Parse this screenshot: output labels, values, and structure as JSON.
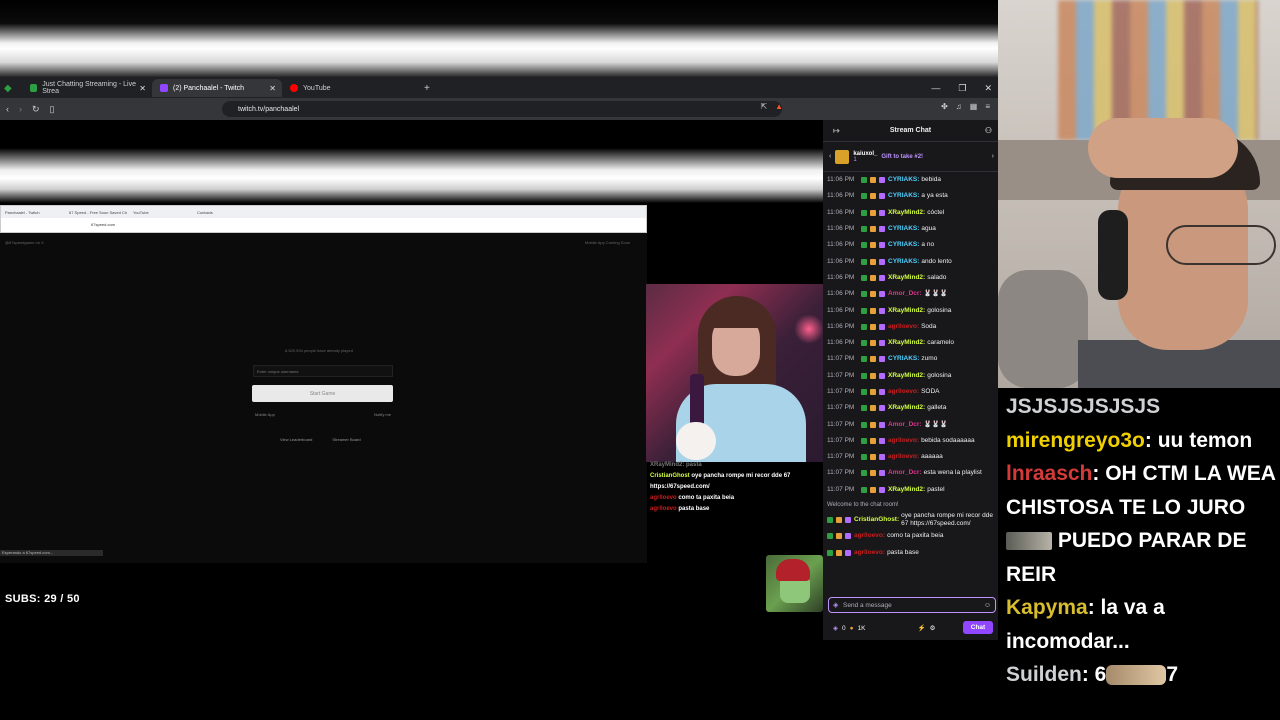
{
  "browser": {
    "tabs": [
      {
        "label": "Just Chatting Streaming - Live Strea",
        "color": "#2ea043"
      },
      {
        "label": "(2) Panchaalel - Twitch",
        "color": "#9147ff"
      },
      {
        "label": "YouTube",
        "color": "#ff0000"
      }
    ],
    "url": "twitch.tv/panchaalel"
  },
  "inner_page": {
    "tab_labels": [
      "Panchaalel - Twitch",
      "67 Speed - Free Soon Saved Ch",
      "YouTube",
      "Contacts"
    ],
    "url": "67speed.com",
    "header_left": "@67speedgame on X",
    "header_right": "Mobile App Coming Soon",
    "player_count": "6,520,934 people have already played",
    "username_placeholder": "Enter unique username",
    "start_button": "Start Game",
    "mobile_app": "Mobile App",
    "notify": "Notify me",
    "leaderboard": "View Leaderboard",
    "streamer_board": "Streamer Board",
    "status": "Esperando a 67speed.com..."
  },
  "overlay_chat": {
    "header": "XRayMind2: pasta",
    "lines": [
      {
        "user": "CristianGhost",
        "text": "oye pancha rompe mi recor dde 67 https://67speed.com/",
        "color": "#d4ff3f"
      },
      {
        "user": "agrlloevo",
        "text": "como ta paxita beia",
        "color": "#c81e1e"
      },
      {
        "user": "agrlloevo",
        "text": "pasta base",
        "color": "#c81e1e"
      }
    ]
  },
  "subs": "SUBS: 29 / 50",
  "chat": {
    "title": "Stream Chat",
    "pinned_user": "kaiuxol_",
    "pinned_count": "1",
    "pinned_text": "Gift to take #2!",
    "messages": [
      {
        "time": "11:06 PM",
        "user": "CYRIAKS",
        "text": "bebida",
        "color": "#4fd1ff"
      },
      {
        "time": "11:06 PM",
        "user": "CYRIAKS",
        "text": "a ya esta",
        "color": "#4fd1ff"
      },
      {
        "time": "11:06 PM",
        "user": "XRayMind2",
        "text": "cóctel",
        "color": "#d4ff3f"
      },
      {
        "time": "11:06 PM",
        "user": "CYRIAKS",
        "text": "agua",
        "color": "#4fd1ff"
      },
      {
        "time": "11:06 PM",
        "user": "CYRIAKS",
        "text": "a no",
        "color": "#4fd1ff"
      },
      {
        "time": "11:06 PM",
        "user": "CYRIAKS",
        "text": "ando lento",
        "color": "#4fd1ff"
      },
      {
        "time": "11:06 PM",
        "user": "XRayMind2",
        "text": "salado",
        "color": "#d4ff3f"
      },
      {
        "time": "11:06 PM",
        "user": "Amor_Dcr",
        "text": "🐰🐰🐰",
        "color": "#e0368a"
      },
      {
        "time": "11:06 PM",
        "user": "XRayMind2",
        "text": "golosina",
        "color": "#d4ff3f"
      },
      {
        "time": "11:06 PM",
        "user": "agrlloevo",
        "text": "Soda",
        "color": "#c81e1e"
      },
      {
        "time": "11:06 PM",
        "user": "XRayMind2",
        "text": "caramelo",
        "color": "#d4ff3f"
      },
      {
        "time": "11:07 PM",
        "user": "CYRIAKS",
        "text": "zumo",
        "color": "#4fd1ff"
      },
      {
        "time": "11:07 PM",
        "user": "XRayMind2",
        "text": "golosina",
        "color": "#d4ff3f"
      },
      {
        "time": "11:07 PM",
        "user": "agrlloevo",
        "text": "SODA",
        "color": "#c81e1e"
      },
      {
        "time": "11:07 PM",
        "user": "XRayMind2",
        "text": "galleta",
        "color": "#d4ff3f"
      },
      {
        "time": "11:07 PM",
        "user": "Amor_Dcr",
        "text": "🐰🐰🐰",
        "color": "#e0368a"
      },
      {
        "time": "11:07 PM",
        "user": "agrlloevo",
        "text": "bebida sodaaaaaa",
        "color": "#c81e1e"
      },
      {
        "time": "11:07 PM",
        "user": "agrlloevo",
        "text": "aaaaaa",
        "color": "#c81e1e"
      },
      {
        "time": "11:07 PM",
        "user": "Amor_Dcr",
        "text": "esta wena la playlist",
        "color": "#e0368a"
      },
      {
        "time": "11:07 PM",
        "user": "XRayMind2",
        "text": "pastel",
        "color": "#d4ff3f"
      }
    ],
    "welcome": "Welcome to the chat room!",
    "recent": [
      {
        "user": "CristianGhost",
        "text": "oye pancha rompe mi recor dde 67 https://67speed.com/",
        "color": "#d4ff3f"
      },
      {
        "user": "agrlloevo",
        "text": "como ta paxita beia",
        "color": "#c81e1e"
      },
      {
        "user": "agrlloevo",
        "text": "pasta base",
        "color": "#c81e1e"
      }
    ],
    "input_placeholder": "Send a message",
    "points": "0",
    "bits": "1K",
    "chat_button": "Chat"
  },
  "big_chat": [
    {
      "user": "",
      "text": "JSJSJSJSJSJS",
      "cls": "n4"
    },
    {
      "user": "mirengreyo3o",
      "text": "uu temon",
      "cls": "n1"
    },
    {
      "user": "lnraasch",
      "text": "OH CTM LA WEA CHISTOSA TE LO JURO",
      "tail": "PUEDO PARAR DE REIR",
      "cls": "n2"
    },
    {
      "user": "Kapyma",
      "text": "la va a incomodar...",
      "cls": "n2"
    },
    {
      "user": "Suilden",
      "text": "6",
      "tail": "7",
      "cls": "n4"
    }
  ]
}
